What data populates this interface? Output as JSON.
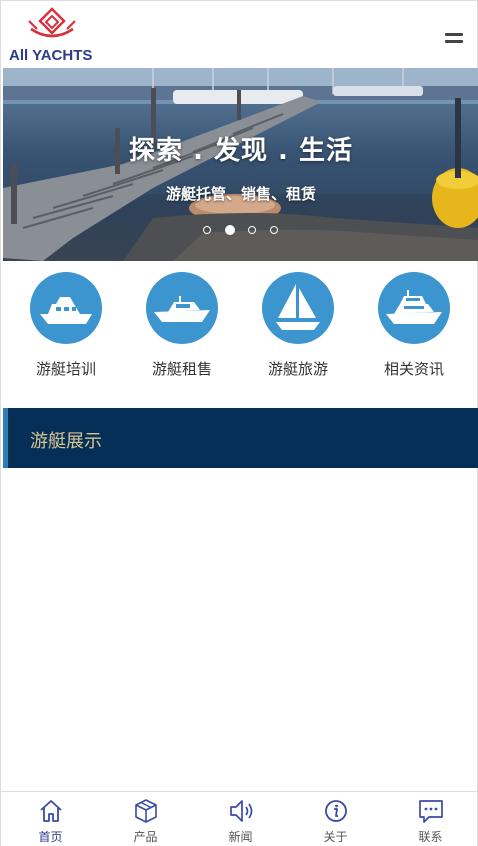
{
  "header": {
    "logo_text": "All YACHTS",
    "menu_icon": "hamburger-menu-icon"
  },
  "banner": {
    "title": "探索 . 发现 . 生活",
    "subtitle": "游艇托管、销售、租赁",
    "slide_count": 4,
    "active_slide": 2
  },
  "categories": [
    {
      "label": "游艇培训",
      "icon": "motor-yacht-icon"
    },
    {
      "label": "游艇租售",
      "icon": "speedboat-icon"
    },
    {
      "label": "游艇旅游",
      "icon": "sailboat-icon"
    },
    {
      "label": "相关资讯",
      "icon": "cruiser-yacht-icon"
    }
  ],
  "section": {
    "title": "游艇展示"
  },
  "bottom_nav": [
    {
      "label": "首页",
      "icon": "home-icon",
      "active": true
    },
    {
      "label": "产品",
      "icon": "cube-icon",
      "active": false
    },
    {
      "label": "新闻",
      "icon": "speaker-icon",
      "active": false
    },
    {
      "label": "关于",
      "icon": "info-icon",
      "active": false
    },
    {
      "label": "联系",
      "icon": "chat-icon",
      "active": false
    }
  ],
  "colors": {
    "brand": "#2e3a8c",
    "logo_red": "#d9303a",
    "icon_blue": "#3c95cf",
    "section_bg": "#062f58",
    "section_text": "#d8c58f",
    "nav_icon": "#3b4aa8"
  }
}
